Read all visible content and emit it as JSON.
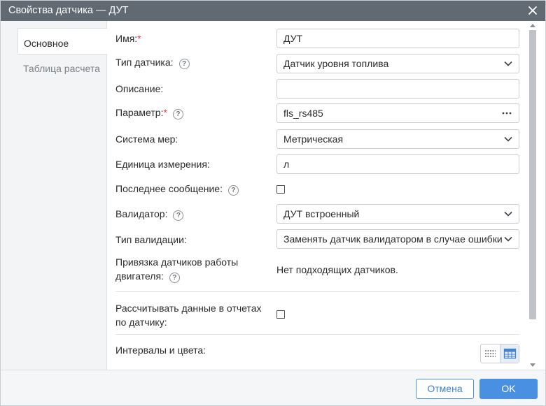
{
  "window": {
    "title": "Свойства датчика — ДУТ"
  },
  "tabs": [
    {
      "label": "Основное",
      "active": true
    },
    {
      "label": "Таблица расчета",
      "active": false
    }
  ],
  "form": {
    "name": {
      "label": "Имя:",
      "required": "*",
      "value": "ДУТ"
    },
    "sensor_type": {
      "label": "Тип датчика:",
      "help": "?",
      "value": "Датчик уровня топлива"
    },
    "description": {
      "label": "Описание:",
      "value": ""
    },
    "parameter": {
      "label": "Параметр:",
      "required": "*",
      "help": "?",
      "value": "fls_rs485"
    },
    "measure_system": {
      "label": "Система мер:",
      "value": "Метрическая"
    },
    "unit": {
      "label": "Единица измерения:",
      "value": "л"
    },
    "last_message": {
      "label": "Последнее сообщение:",
      "help": "?",
      "checked": false
    },
    "validator": {
      "label": "Валидатор:",
      "help": "?",
      "value": "ДУТ встроенный"
    },
    "validation_type": {
      "label": "Тип валидации:",
      "value": "Заменять датчик валидатором в случае ошибки"
    },
    "engine_binding": {
      "label_line1": "Привязка датчиков работы",
      "label_line2": "двигателя:",
      "help": "?",
      "value": "Нет подходящих датчиков."
    },
    "calc_reports": {
      "label_line1": "Рассчитывать данные в отчетах",
      "label_line2": "по датчику:",
      "checked": false
    },
    "intervals": {
      "label": "Интервалы и цвета:"
    }
  },
  "footer": {
    "cancel_label": "Отмена",
    "ok_label": "OK"
  },
  "colors": {
    "titlebar": "#616a73",
    "accent": "#4a90e2",
    "required": "#e53935"
  }
}
